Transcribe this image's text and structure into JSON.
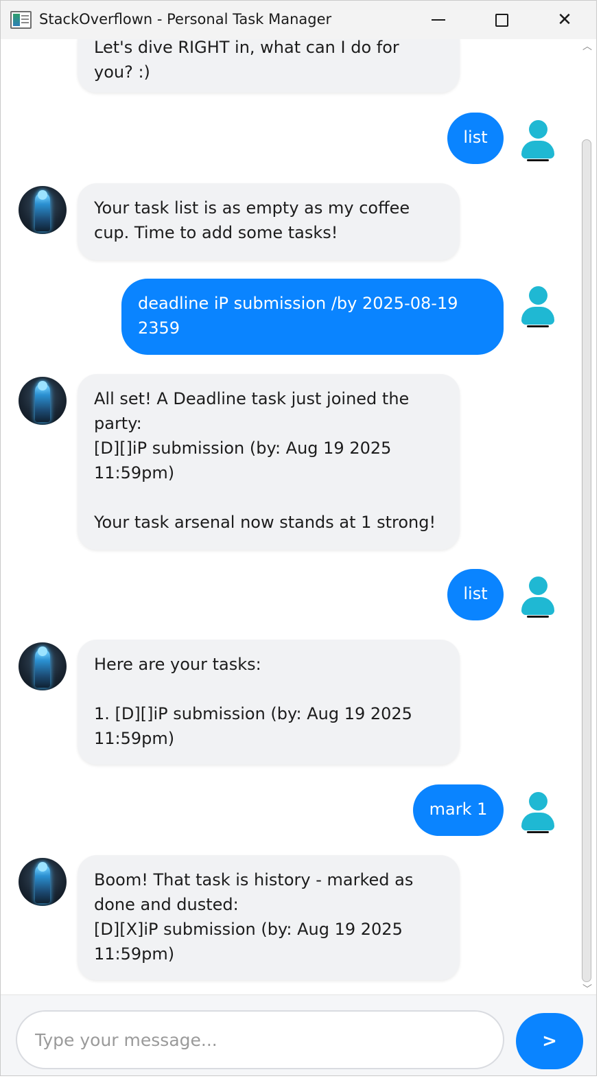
{
  "window": {
    "title": "StackOverflown - Personal Task Manager",
    "icons": {
      "app": "app-window-icon",
      "minimize": "minimize-icon",
      "maximize": "maximize-icon",
      "close": "close-icon"
    },
    "close_glyph": "✕"
  },
  "chat": {
    "messages": [
      {
        "sender": "bot",
        "text": "Let's dive RIGHT in, what can I do for\nyou? :)"
      },
      {
        "sender": "user",
        "text": "list"
      },
      {
        "sender": "bot",
        "text": "Your task list is as empty as my coffee\ncup. Time to add some tasks!"
      },
      {
        "sender": "user",
        "text": "deadline iP submission /by 2025-08-19\n2359"
      },
      {
        "sender": "bot",
        "text": "All set! A Deadline task just joined the\nparty:\n[D][]iP submission (by: Aug 19 2025\n11:59pm)\n\nYour task arsenal now stands at 1 strong!"
      },
      {
        "sender": "user",
        "text": "list"
      },
      {
        "sender": "bot",
        "text": "Here are your tasks:\n\n1. [D][]iP submission (by: Aug 19 2025\n11:59pm)"
      },
      {
        "sender": "user",
        "text": "mark 1"
      },
      {
        "sender": "bot",
        "text": "Boom! That task is history - marked as\ndone and dusted:\n[D][X]iP submission (by: Aug 19 2025\n11:59pm)"
      }
    ]
  },
  "scrollbar": {
    "up_glyph": "︿",
    "down_glyph": "﹀"
  },
  "input": {
    "placeholder": "Type your message...",
    "value": "",
    "send_label": ">"
  },
  "colors": {
    "user_bubble": "#0a84ff",
    "bot_bubble": "#f1f2f4",
    "user_avatar": "#1fb8d3",
    "send_button": "#0a84ff"
  }
}
